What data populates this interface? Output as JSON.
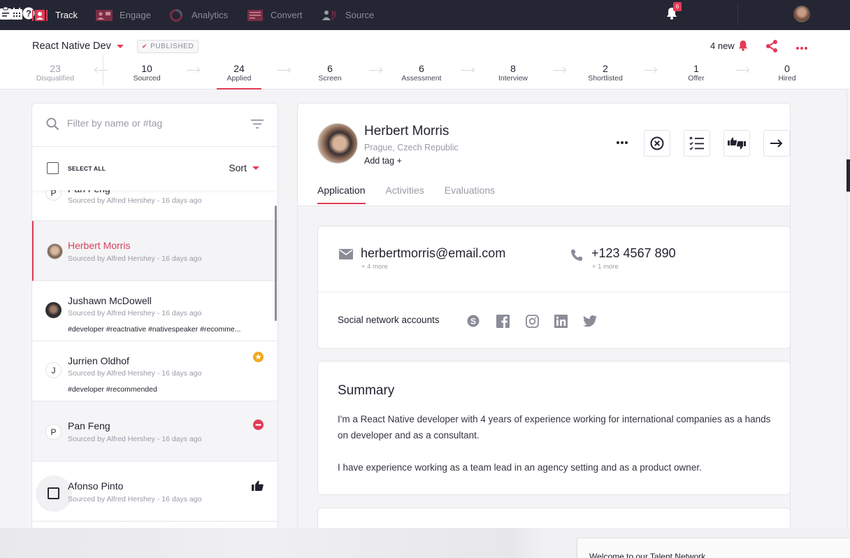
{
  "topnav": {
    "items": [
      {
        "label": "Track",
        "icon": "track-icon",
        "active": true
      },
      {
        "label": "Engage",
        "icon": "engage-icon",
        "active": false
      },
      {
        "label": "Analytics",
        "icon": "analytics-icon",
        "active": false
      },
      {
        "label": "Convert",
        "icon": "convert-icon",
        "active": false
      },
      {
        "label": "Source",
        "icon": "source-icon",
        "active": false
      }
    ],
    "notifications_count": "6",
    "right_icons": [
      "clipboard-icon",
      "bell-icon",
      "calendar-icon",
      "help-icon",
      "user-avatar"
    ]
  },
  "job": {
    "title": "React Native Dev",
    "status_badge": "PUBLISHED",
    "new_notifications": "4 new",
    "stages": [
      {
        "count": "23",
        "label": "Disqualified"
      },
      {
        "count": "10",
        "label": "Sourced"
      },
      {
        "count": "24",
        "label": "Applied"
      },
      {
        "count": "6",
        "label": "Screen"
      },
      {
        "count": "6",
        "label": "Assessment"
      },
      {
        "count": "8",
        "label": "Interview"
      },
      {
        "count": "2",
        "label": "Shortlisted"
      },
      {
        "count": "1",
        "label": "Offer"
      },
      {
        "count": "0",
        "label": "Hired"
      }
    ],
    "active_stage": "Applied"
  },
  "candidate_list": {
    "filter_placeholder": "Filter by name or #tag",
    "filter_value": "",
    "select_all_label": "SELECT ALL",
    "sort_label": "Sort",
    "candidates": [
      {
        "name": "Pan Feng",
        "initial": "P",
        "meta": "Sourced by Alfred Hershey  -  16 days ago",
        "tags": "",
        "status": ""
      },
      {
        "name": "Herbert Morris",
        "initial": "",
        "meta": "Sourced by Alfred Hershey  -  16 days ago",
        "tags": "",
        "status": "selected"
      },
      {
        "name": "Jushawn McDowell",
        "initial": "",
        "meta": "Sourced by Alfred Hershey  -  16 days ago",
        "tags": "#developer  #reactnative  #nativespeaker  #recomme...",
        "status": ""
      },
      {
        "name": "Jurrien Oldhof",
        "initial": "J",
        "meta": "Sourced by Alfred Hershey  -  16 days ago",
        "tags": "#developer  #recommended",
        "status": "starred"
      },
      {
        "name": "Pan Feng",
        "initial": "P",
        "meta": "Sourced by Alfred Hershey  -  16 days ago",
        "tags": "",
        "status": "disqualified"
      },
      {
        "name": "Afonso Pinto",
        "initial": "",
        "meta": "Sourced by Alfred Hershey  -  16 days ago",
        "tags": "",
        "status": "thumbs-up"
      }
    ]
  },
  "profile": {
    "name": "Herbert Morris",
    "location": "Prague, Czech Republic",
    "add_tag": "Add tag +",
    "tabs": [
      "Application",
      "Activities",
      "Evaluations"
    ],
    "active_tab": "Application",
    "email": "herbertmorris@email.com",
    "email_more": "+ 4 more",
    "phone": "+123 4567 890",
    "phone_more": "+ 1 more",
    "social_label": "Social network accounts",
    "social_icons": [
      "skype-icon",
      "facebook-icon",
      "instagram-icon",
      "linkedin-icon",
      "twitter-icon"
    ],
    "summary_title": "Summary",
    "summary_paragraphs": [
      "I'm a React Native developer with 4 years of experience working for international companies as a hands on developer and as a consultant.",
      "I have experience working as a team lead in an agency setting and as a product owner."
    ]
  },
  "overlay": {
    "bottom_text": "Welcome to our Talent Network"
  },
  "colors": {
    "accent": "#e33a57",
    "nav_bg": "#242633",
    "star": "#f0a820"
  }
}
